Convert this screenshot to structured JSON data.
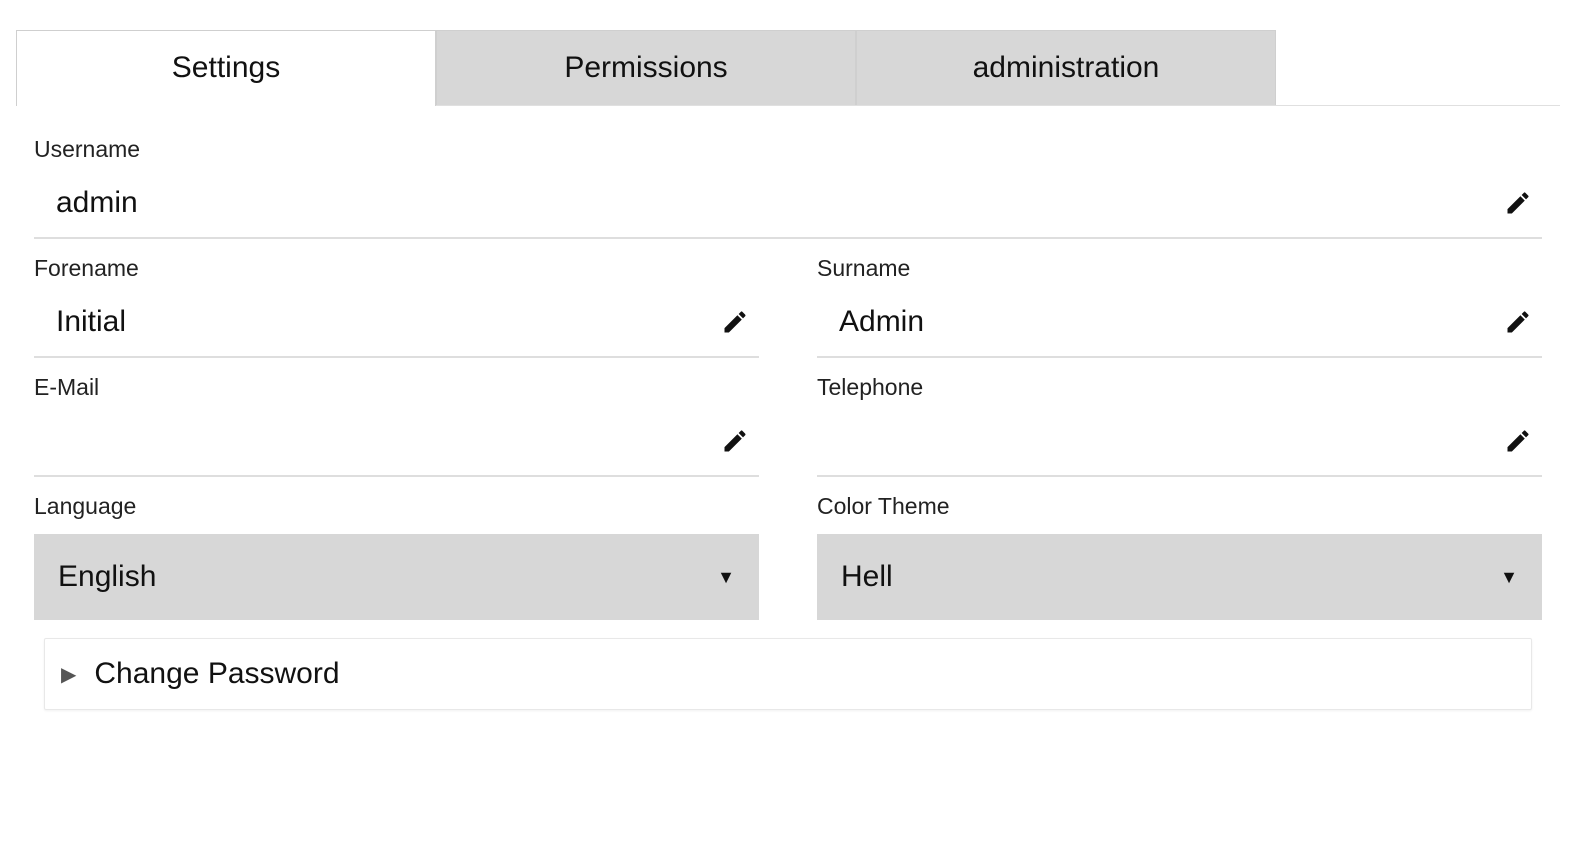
{
  "tabs": {
    "settings": "Settings",
    "permissions": "Permissions",
    "administration": "administration"
  },
  "fields": {
    "username": {
      "label": "Username",
      "value": "admin"
    },
    "forename": {
      "label": "Forename",
      "value": "Initial"
    },
    "surname": {
      "label": "Surname",
      "value": "Admin"
    },
    "email": {
      "label": "E-Mail",
      "value": ""
    },
    "telephone": {
      "label": "Telephone",
      "value": ""
    },
    "language": {
      "label": "Language",
      "value": "English"
    },
    "color_theme": {
      "label": "Color Theme",
      "value": "Hell"
    }
  },
  "accordion": {
    "change_password": "Change Password"
  }
}
